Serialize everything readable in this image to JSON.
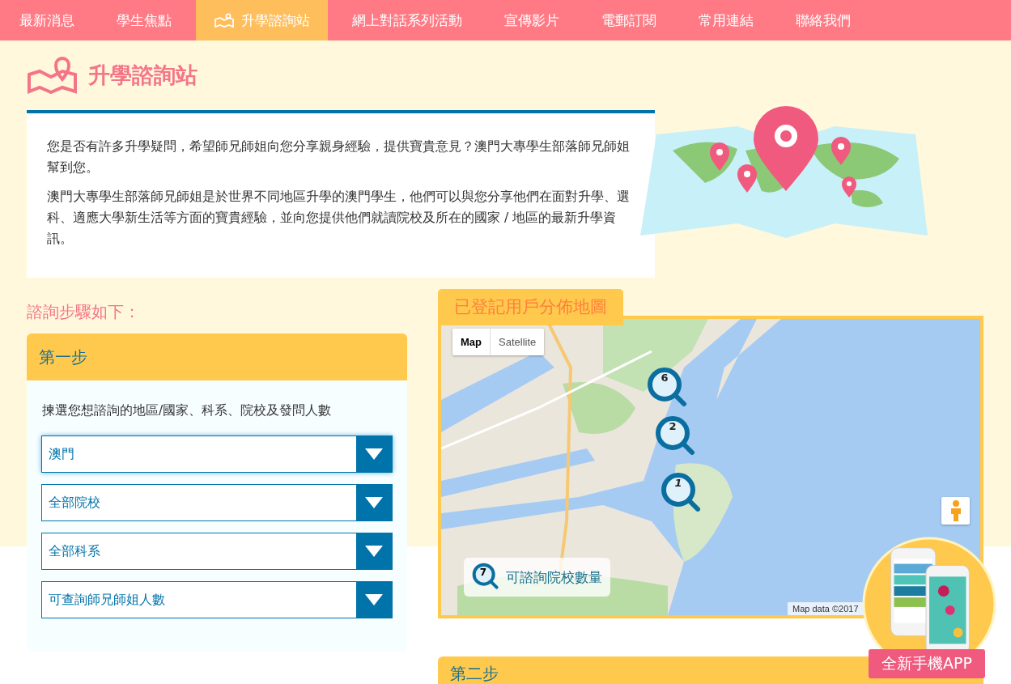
{
  "nav": {
    "items": [
      {
        "label": "最新消息",
        "selected": false,
        "icon": false
      },
      {
        "label": "學生焦點",
        "selected": false,
        "icon": false
      },
      {
        "label": "升學諮詢站",
        "selected": true,
        "icon": true
      },
      {
        "label": "網上對話系列活動",
        "selected": false,
        "icon": false
      },
      {
        "label": "宣傳影片",
        "selected": false,
        "icon": false
      },
      {
        "label": "電郵訂閱",
        "selected": false,
        "icon": false
      },
      {
        "label": "常用連結",
        "selected": false,
        "icon": false
      },
      {
        "label": "聯絡我們",
        "selected": false,
        "icon": false
      }
    ]
  },
  "page_title": "升學諮詢站",
  "intro": {
    "paragraphs": [
      "您是否有許多升學疑問，希望師兄師姐向您分享親身經驗，提供寶貴意見？澳門大專學生部落師兄師姐幫到您。",
      "澳門大專學生部落師兄師姐是於世界不同地區升學的澳門學生，他們可以與您分享他們在面對升學、選科、適應大學新生活等方面的寶貴經驗，並向您提供他們就讀院校及所在的國家 / 地區的最新升學資訊。"
    ]
  },
  "steps_heading": "諮詢步驟如下：",
  "step1": {
    "title": "第一步",
    "instruction": "揀選您想諮詢的地區/國家、科系、院校及發問人數",
    "selects": [
      {
        "value": "澳門",
        "focused": true
      },
      {
        "value": "全部院校",
        "focused": false
      },
      {
        "value": "全部科系",
        "focused": false
      },
      {
        "value": "可查詢師兄師姐人數",
        "focused": false
      }
    ]
  },
  "map": {
    "title": "已登記用戶分佈地圖",
    "type_buttons": [
      {
        "label": "Map",
        "selected": true
      },
      {
        "label": "Satellite",
        "selected": false
      }
    ],
    "clusters": [
      {
        "count": "6",
        "italic": false
      },
      {
        "count": "2",
        "italic": false
      },
      {
        "count": "1",
        "italic": true
      }
    ],
    "legend": {
      "count": "7",
      "label": "可諮詢院校數量"
    },
    "attribution": "Map data ©2017"
  },
  "step2": {
    "title": "第二步"
  },
  "app_badge": {
    "label": "全新手機APP"
  }
}
